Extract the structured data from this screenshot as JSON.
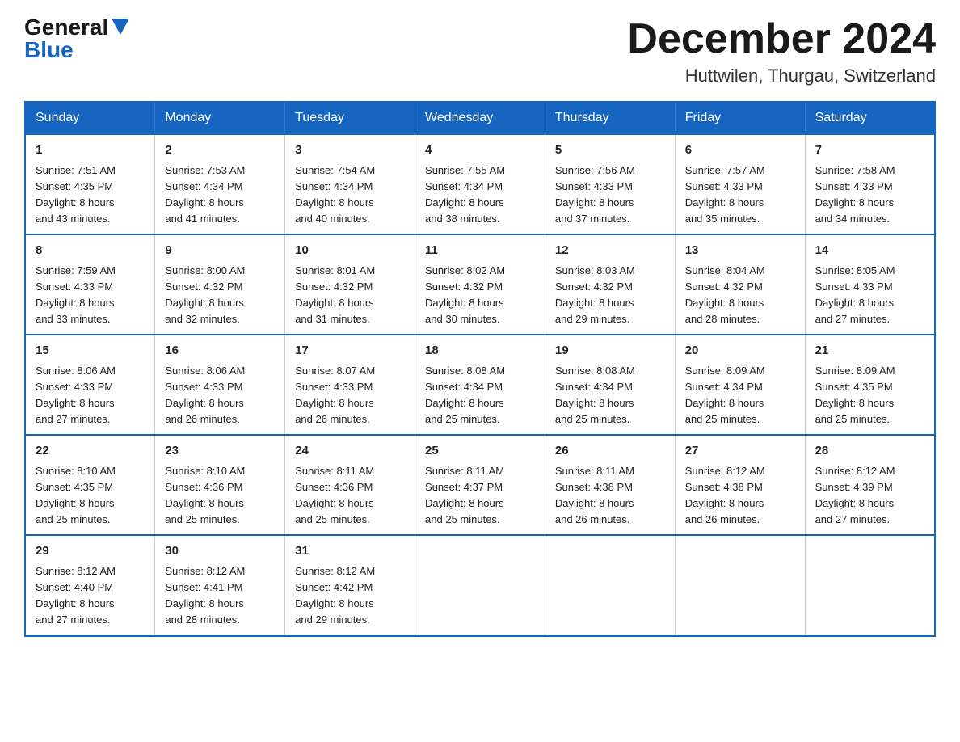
{
  "logo": {
    "general": "General",
    "blue": "Blue"
  },
  "title": "December 2024",
  "location": "Huttwilen, Thurgau, Switzerland",
  "days_of_week": [
    "Sunday",
    "Monday",
    "Tuesday",
    "Wednesday",
    "Thursday",
    "Friday",
    "Saturday"
  ],
  "weeks": [
    [
      {
        "day": "1",
        "sunrise": "7:51 AM",
        "sunset": "4:35 PM",
        "daylight": "8 hours and 43 minutes."
      },
      {
        "day": "2",
        "sunrise": "7:53 AM",
        "sunset": "4:34 PM",
        "daylight": "8 hours and 41 minutes."
      },
      {
        "day": "3",
        "sunrise": "7:54 AM",
        "sunset": "4:34 PM",
        "daylight": "8 hours and 40 minutes."
      },
      {
        "day": "4",
        "sunrise": "7:55 AM",
        "sunset": "4:34 PM",
        "daylight": "8 hours and 38 minutes."
      },
      {
        "day": "5",
        "sunrise": "7:56 AM",
        "sunset": "4:33 PM",
        "daylight": "8 hours and 37 minutes."
      },
      {
        "day": "6",
        "sunrise": "7:57 AM",
        "sunset": "4:33 PM",
        "daylight": "8 hours and 35 minutes."
      },
      {
        "day": "7",
        "sunrise": "7:58 AM",
        "sunset": "4:33 PM",
        "daylight": "8 hours and 34 minutes."
      }
    ],
    [
      {
        "day": "8",
        "sunrise": "7:59 AM",
        "sunset": "4:33 PM",
        "daylight": "8 hours and 33 minutes."
      },
      {
        "day": "9",
        "sunrise": "8:00 AM",
        "sunset": "4:32 PM",
        "daylight": "8 hours and 32 minutes."
      },
      {
        "day": "10",
        "sunrise": "8:01 AM",
        "sunset": "4:32 PM",
        "daylight": "8 hours and 31 minutes."
      },
      {
        "day": "11",
        "sunrise": "8:02 AM",
        "sunset": "4:32 PM",
        "daylight": "8 hours and 30 minutes."
      },
      {
        "day": "12",
        "sunrise": "8:03 AM",
        "sunset": "4:32 PM",
        "daylight": "8 hours and 29 minutes."
      },
      {
        "day": "13",
        "sunrise": "8:04 AM",
        "sunset": "4:32 PM",
        "daylight": "8 hours and 28 minutes."
      },
      {
        "day": "14",
        "sunrise": "8:05 AM",
        "sunset": "4:33 PM",
        "daylight": "8 hours and 27 minutes."
      }
    ],
    [
      {
        "day": "15",
        "sunrise": "8:06 AM",
        "sunset": "4:33 PM",
        "daylight": "8 hours and 27 minutes."
      },
      {
        "day": "16",
        "sunrise": "8:06 AM",
        "sunset": "4:33 PM",
        "daylight": "8 hours and 26 minutes."
      },
      {
        "day": "17",
        "sunrise": "8:07 AM",
        "sunset": "4:33 PM",
        "daylight": "8 hours and 26 minutes."
      },
      {
        "day": "18",
        "sunrise": "8:08 AM",
        "sunset": "4:34 PM",
        "daylight": "8 hours and 25 minutes."
      },
      {
        "day": "19",
        "sunrise": "8:08 AM",
        "sunset": "4:34 PM",
        "daylight": "8 hours and 25 minutes."
      },
      {
        "day": "20",
        "sunrise": "8:09 AM",
        "sunset": "4:34 PM",
        "daylight": "8 hours and 25 minutes."
      },
      {
        "day": "21",
        "sunrise": "8:09 AM",
        "sunset": "4:35 PM",
        "daylight": "8 hours and 25 minutes."
      }
    ],
    [
      {
        "day": "22",
        "sunrise": "8:10 AM",
        "sunset": "4:35 PM",
        "daylight": "8 hours and 25 minutes."
      },
      {
        "day": "23",
        "sunrise": "8:10 AM",
        "sunset": "4:36 PM",
        "daylight": "8 hours and 25 minutes."
      },
      {
        "day": "24",
        "sunrise": "8:11 AM",
        "sunset": "4:36 PM",
        "daylight": "8 hours and 25 minutes."
      },
      {
        "day": "25",
        "sunrise": "8:11 AM",
        "sunset": "4:37 PM",
        "daylight": "8 hours and 25 minutes."
      },
      {
        "day": "26",
        "sunrise": "8:11 AM",
        "sunset": "4:38 PM",
        "daylight": "8 hours and 26 minutes."
      },
      {
        "day": "27",
        "sunrise": "8:12 AM",
        "sunset": "4:38 PM",
        "daylight": "8 hours and 26 minutes."
      },
      {
        "day": "28",
        "sunrise": "8:12 AM",
        "sunset": "4:39 PM",
        "daylight": "8 hours and 27 minutes."
      }
    ],
    [
      {
        "day": "29",
        "sunrise": "8:12 AM",
        "sunset": "4:40 PM",
        "daylight": "8 hours and 27 minutes."
      },
      {
        "day": "30",
        "sunrise": "8:12 AM",
        "sunset": "4:41 PM",
        "daylight": "8 hours and 28 minutes."
      },
      {
        "day": "31",
        "sunrise": "8:12 AM",
        "sunset": "4:42 PM",
        "daylight": "8 hours and 29 minutes."
      },
      null,
      null,
      null,
      null
    ]
  ],
  "labels": {
    "sunrise": "Sunrise: ",
    "sunset": "Sunset: ",
    "daylight": "Daylight: "
  }
}
